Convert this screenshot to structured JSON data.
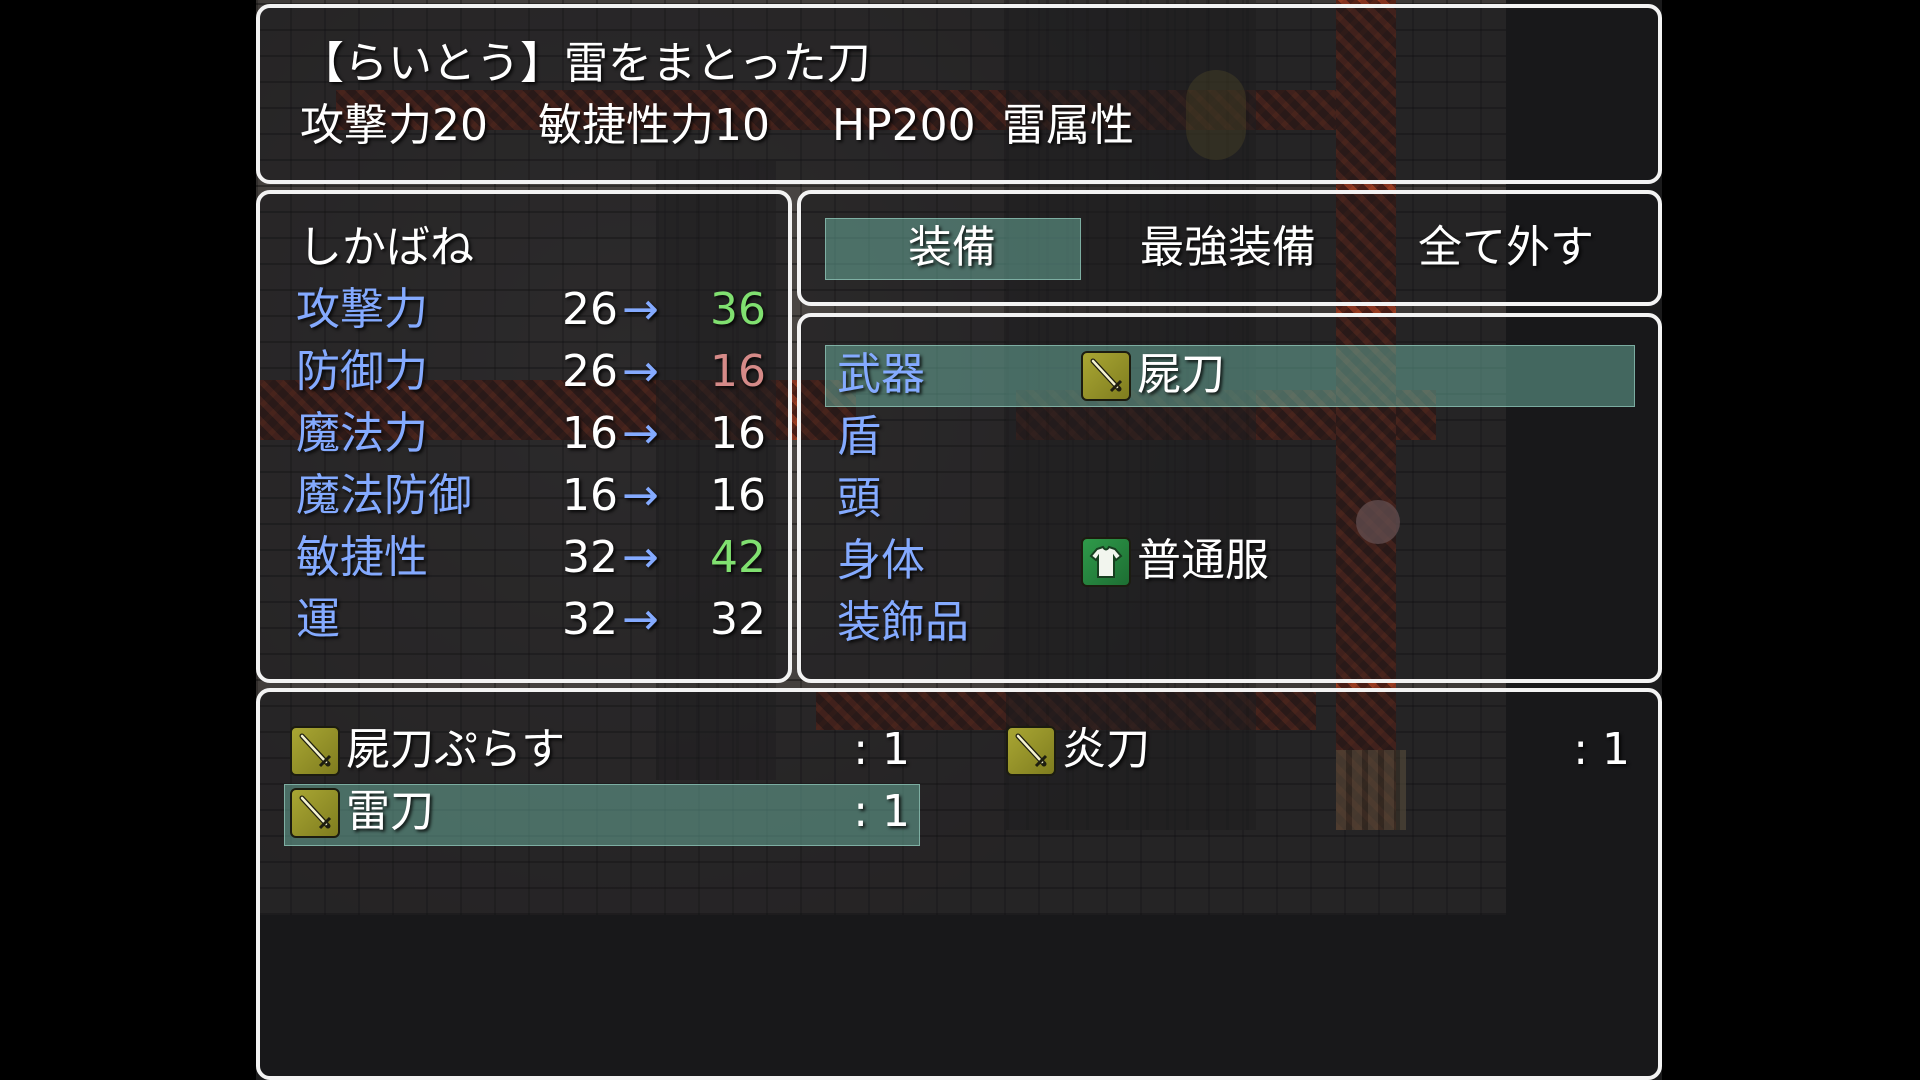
{
  "help": {
    "item_title": "【らいとう】雷をまとった刀",
    "stats": [
      "攻撃力20",
      "敏捷性力10",
      "HP200",
      "雷属性"
    ]
  },
  "status": {
    "actor_name": "しかばね",
    "rows": [
      {
        "label": "攻撃力",
        "current": "26",
        "arrow": "→",
        "new": "36",
        "change": "up"
      },
      {
        "label": "防御力",
        "current": "26",
        "arrow": "→",
        "new": "16",
        "change": "down"
      },
      {
        "label": "魔法力",
        "current": "16",
        "arrow": "→",
        "new": "16",
        "change": "same"
      },
      {
        "label": "魔法防御",
        "current": "16",
        "arrow": "→",
        "new": "16",
        "change": "same"
      },
      {
        "label": "敏捷性",
        "current": "32",
        "arrow": "→",
        "new": "42",
        "change": "up"
      },
      {
        "label": "運",
        "current": "32",
        "arrow": "→",
        "new": "32",
        "change": "same"
      }
    ]
  },
  "commands": {
    "equip": "装備",
    "optimize": "最強装備",
    "clear": "全て外す",
    "selected": "equip"
  },
  "slots": [
    {
      "label": "武器",
      "item": "屍刀",
      "icon": "sword-icon",
      "selected": true
    },
    {
      "label": "盾",
      "item": "",
      "icon": ""
    },
    {
      "label": "頭",
      "item": "",
      "icon": ""
    },
    {
      "label": "身体",
      "item": "普通服",
      "icon": "clothes-icon"
    },
    {
      "label": "装飾品",
      "item": "",
      "icon": ""
    }
  ],
  "items": [
    {
      "name": "屍刀ぷらす",
      "count": ": 1",
      "icon": "sword-icon"
    },
    {
      "name": "炎刀",
      "count": ": 1",
      "icon": "sword-icon"
    },
    {
      "name": "雷刀",
      "count": ": 1",
      "icon": "sword-icon",
      "selected": true
    }
  ],
  "colors": {
    "system_label": "#84aaff",
    "stat_up": "#80e070",
    "stat_down": "#d58a88",
    "selection": "#78c8b4"
  }
}
